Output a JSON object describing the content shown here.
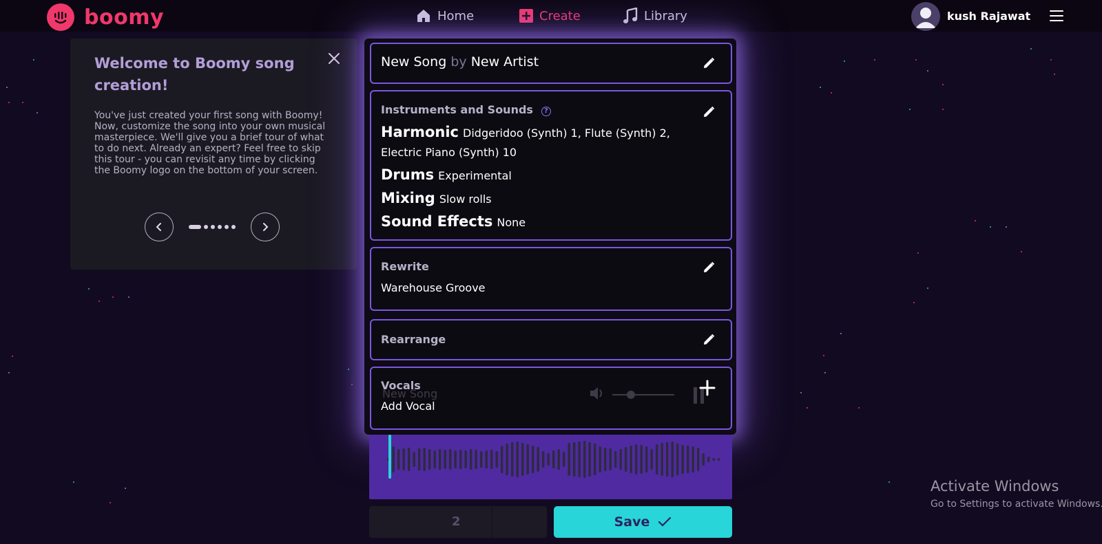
{
  "brand": {
    "name": "boomy",
    "accent": "#f0386b"
  },
  "nav": {
    "home": "Home",
    "create": "Create",
    "library": "Library"
  },
  "user": {
    "name": "kush Rajawat"
  },
  "tour": {
    "title": "Welcome to Boomy song creation!",
    "body": "You've just created your first song with Boomy! Now, customize the song into your own musical masterpiece. We'll give you a brief tour of what to do next. Already an expert? Feel free to skip this tour - you can revisit any time by clicking the Boomy logo on the bottom of your screen.",
    "step": 1,
    "total_steps": 6
  },
  "song": {
    "title": "New Song",
    "by": "by",
    "artist": "New Artist"
  },
  "instruments": {
    "heading": "Instruments and Sounds",
    "help": "?",
    "harmonic_label": "Harmonic",
    "harmonic_value": "Didgeridoo (Synth) 1, Flute (Synth) 2, Electric Piano (Synth) 10",
    "drums_label": "Drums",
    "drums_value": "Experimental",
    "mixing_label": "Mixing",
    "mixing_value": "Slow rolls",
    "sfx_label": "Sound Effects",
    "sfx_value": "None"
  },
  "rewrite": {
    "heading": "Rewrite",
    "value": "Warehouse Groove"
  },
  "rearrange": {
    "heading": "Rearrange"
  },
  "vocals": {
    "heading": "Vocals",
    "value": "Add Vocal",
    "ghost_title": "New Song"
  },
  "bottom": {
    "stepper_value": "2",
    "save_label": "Save"
  },
  "watermark": {
    "title": "Activate Windows",
    "subtitle": "Go to Settings to activate Windows."
  }
}
